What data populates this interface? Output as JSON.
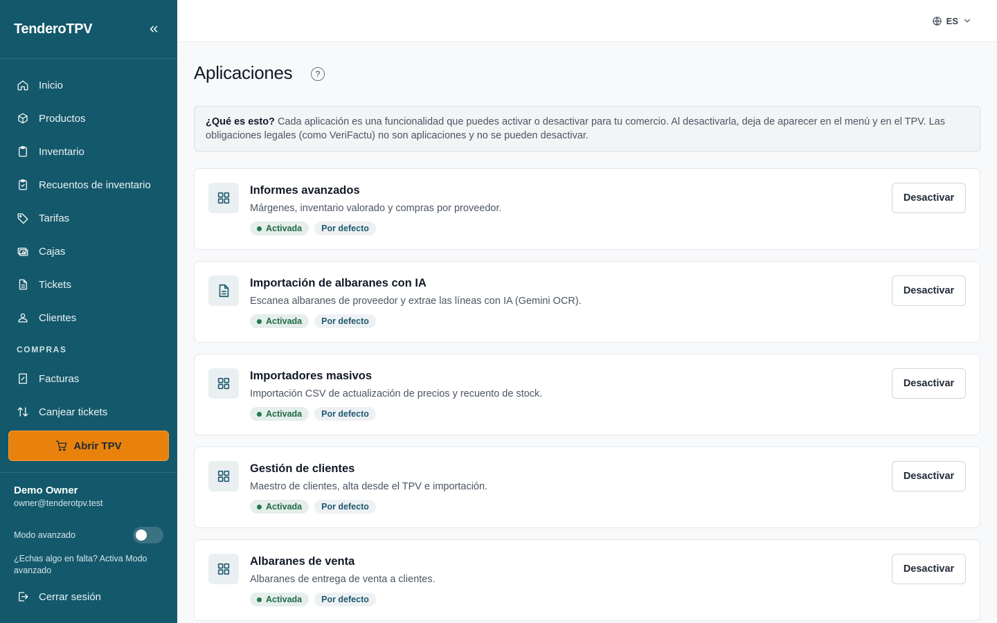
{
  "sidebar": {
    "brand": "TenderoTPV",
    "items": [
      {
        "label": "Inicio",
        "icon": "home-icon"
      },
      {
        "label": "Productos",
        "icon": "box-icon"
      },
      {
        "label": "Inventario",
        "icon": "clipboard-icon"
      },
      {
        "label": "Recuentos de inventario",
        "icon": "clipboard-check-icon"
      },
      {
        "label": "Tarifas",
        "icon": "tag-icon"
      },
      {
        "label": "Cajas",
        "icon": "cash-register-icon"
      },
      {
        "label": "Tickets",
        "icon": "document-icon"
      },
      {
        "label": "Clientes",
        "icon": "users-icon"
      }
    ],
    "section_compras": "COMPRAS",
    "compras_items": [
      {
        "label": "Facturas",
        "icon": "invoice-icon"
      },
      {
        "label": "Canjear tickets",
        "icon": "swap-icon"
      }
    ],
    "tpv_button": "Abrir TPV",
    "user_name": "Demo Owner",
    "user_email": "owner@tenderotpv.test",
    "advanced_mode_label": "Modo avanzado",
    "advanced_mode_on": false,
    "advanced_hint": "¿Echas algo en falta? Activa Modo avanzado",
    "logout": "Cerrar sesión"
  },
  "topbar": {
    "language": "ES"
  },
  "main": {
    "title": "Aplicaciones",
    "help": "?",
    "info_bold": "¿Qué es esto?",
    "info_text": " Cada aplicación es una funcionalidad que puedes activar o desactivar para tu comercio. Al desactivarla, deja de aparecer en el menú y en el TPV. Las obligaciones legales (como VeriFactu) no son aplicaciones y no se pueden desactivar.",
    "apps": [
      {
        "title": "Informes avanzados",
        "desc": "Márgenes, inventario valorado y compras por proveedor.",
        "status": "Activada",
        "tag": "Por defecto",
        "action": "Desactivar",
        "icon": "grid-icon"
      },
      {
        "title": "Importación de albaranes con IA",
        "desc": "Escanea albaranes de proveedor y extrae las líneas con IA (Gemini OCR).",
        "status": "Activada",
        "tag": "Por defecto",
        "action": "Desactivar",
        "icon": "document-icon"
      },
      {
        "title": "Importadores masivos",
        "desc": "Importación CSV de actualización de precios y recuento de stock.",
        "status": "Activada",
        "tag": "Por defecto",
        "action": "Desactivar",
        "icon": "grid-icon"
      },
      {
        "title": "Gestión de clientes",
        "desc": "Maestro de clientes, alta desde el TPV e importación.",
        "status": "Activada",
        "tag": "Por defecto",
        "action": "Desactivar",
        "icon": "grid-icon"
      },
      {
        "title": "Albaranes de venta",
        "desc": "Albaranes de entrega de venta a clientes.",
        "status": "Activada",
        "tag": "Por defecto",
        "action": "Desactivar",
        "icon": "grid-icon"
      }
    ]
  },
  "colors": {
    "sidebar_bg": "#14586b",
    "accent_orange": "#e8820c",
    "status_green": "#1f7a4c"
  }
}
